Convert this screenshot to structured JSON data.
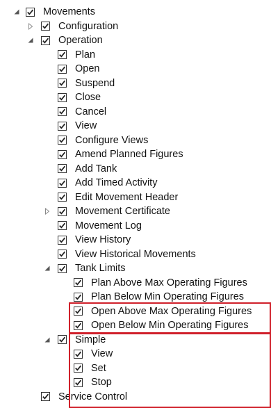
{
  "tree": [
    {
      "label": "Movements",
      "level": 0,
      "expander": "expanded",
      "checked": true
    },
    {
      "label": "Configuration",
      "level": 1,
      "expander": "collapsed",
      "checked": true
    },
    {
      "label": "Operation",
      "level": 1,
      "expander": "expanded",
      "checked": true
    },
    {
      "label": "Plan",
      "level": 2,
      "expander": "none",
      "checked": true
    },
    {
      "label": "Open",
      "level": 2,
      "expander": "none",
      "checked": true
    },
    {
      "label": "Suspend",
      "level": 2,
      "expander": "none",
      "checked": true
    },
    {
      "label": "Close",
      "level": 2,
      "expander": "none",
      "checked": true
    },
    {
      "label": "Cancel",
      "level": 2,
      "expander": "none",
      "checked": true
    },
    {
      "label": "View",
      "level": 2,
      "expander": "none",
      "checked": true
    },
    {
      "label": "Configure Views",
      "level": 2,
      "expander": "none",
      "checked": true
    },
    {
      "label": "Amend Planned Figures",
      "level": 2,
      "expander": "none",
      "checked": true
    },
    {
      "label": "Add Tank",
      "level": 2,
      "expander": "none",
      "checked": true
    },
    {
      "label": "Add Timed Activity",
      "level": 2,
      "expander": "none",
      "checked": true
    },
    {
      "label": "Edit Movement Header",
      "level": 2,
      "expander": "none",
      "checked": true
    },
    {
      "label": "Movement Certificate",
      "level": 2,
      "expander": "collapsed",
      "checked": true
    },
    {
      "label": "Movement Log",
      "level": 2,
      "expander": "none",
      "checked": true
    },
    {
      "label": "View History",
      "level": 2,
      "expander": "none",
      "checked": true
    },
    {
      "label": "View Historical Movements",
      "level": 2,
      "expander": "none",
      "checked": true
    },
    {
      "label": "Tank Limits",
      "level": 2,
      "expander": "expanded",
      "checked": true
    },
    {
      "label": "Plan Above Max Operating Figures",
      "level": 3,
      "expander": "none",
      "checked": true
    },
    {
      "label": "Plan Below Min Operating Figures",
      "level": 3,
      "expander": "none",
      "checked": true
    },
    {
      "label": "Open Above Max Operating Figures",
      "level": 3,
      "expander": "none",
      "checked": true
    },
    {
      "label": "Open Below Min Operating Figures",
      "level": 3,
      "expander": "none",
      "checked": true
    },
    {
      "label": "Simple",
      "level": 2,
      "expander": "expanded",
      "checked": true
    },
    {
      "label": "View",
      "level": 3,
      "expander": "none",
      "checked": true
    },
    {
      "label": "Set",
      "level": 3,
      "expander": "none",
      "checked": true
    },
    {
      "label": "Stop",
      "level": 3,
      "expander": "none",
      "checked": true
    },
    {
      "label": "Service Control",
      "level": 1,
      "expander": "none",
      "checked": true
    }
  ],
  "colors": {
    "highlight": "#d0202a",
    "text": "#111111",
    "checkmark": "#222222",
    "expander": "#555555"
  },
  "icons": {
    "expanded": "expanded-triangle-icon",
    "collapsed": "collapsed-triangle-icon",
    "check": "checkmark-icon"
  }
}
